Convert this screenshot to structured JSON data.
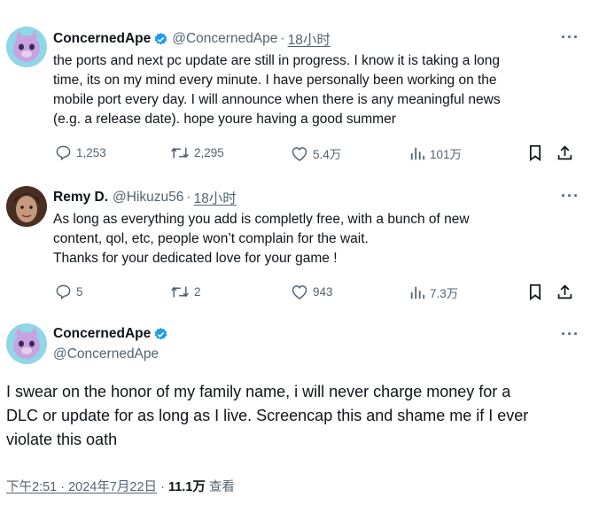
{
  "tweets": [
    {
      "name": "ConcernedApe",
      "handle": "@ConcernedApe",
      "time": "18小时",
      "lines": [
        "the ports and next pc update are still in progress. I know it is taking a long",
        "time, its on my mind every minute. I have personally been working on the",
        "mobile port every day. I will announce when there is any meaningful news",
        "(e.g. a release date). hope youre having a good summer"
      ],
      "replies": "1,253",
      "retweets": "2,295",
      "likes": "5.4万",
      "views": "101万"
    },
    {
      "name": "Remy D.",
      "handle": "@Hikuzu56",
      "time": "18小时",
      "lines": [
        "As long as everything you add is completly free, with a bunch of new",
        "content, qol, etc, people won’t complain for the wait.",
        "Thanks for your dedicated love for your game !"
      ],
      "replies": "5",
      "retweets": "2",
      "likes": "943",
      "views": "7.3万"
    }
  ],
  "main": {
    "name": "ConcernedApe",
    "handle": "@ConcernedApe",
    "lines": [
      "I swear on the honor of my family name,  i will never charge money for a",
      "DLC or update for as long as I live. Screencap this and shame me if I ever",
      "violate this oath"
    ],
    "timestamp": "下午2:51 · 2024年7月22日",
    "views_count": "11.1万",
    "views_label": "查看"
  },
  "colors": {
    "text": "#0f1419",
    "muted": "#536471",
    "verified": "#1d9bf0"
  },
  "icons": [
    "verified-badge-icon",
    "more-icon",
    "reply-icon",
    "retweet-icon",
    "like-icon",
    "views-icon",
    "bookmark-icon",
    "share-icon"
  ]
}
